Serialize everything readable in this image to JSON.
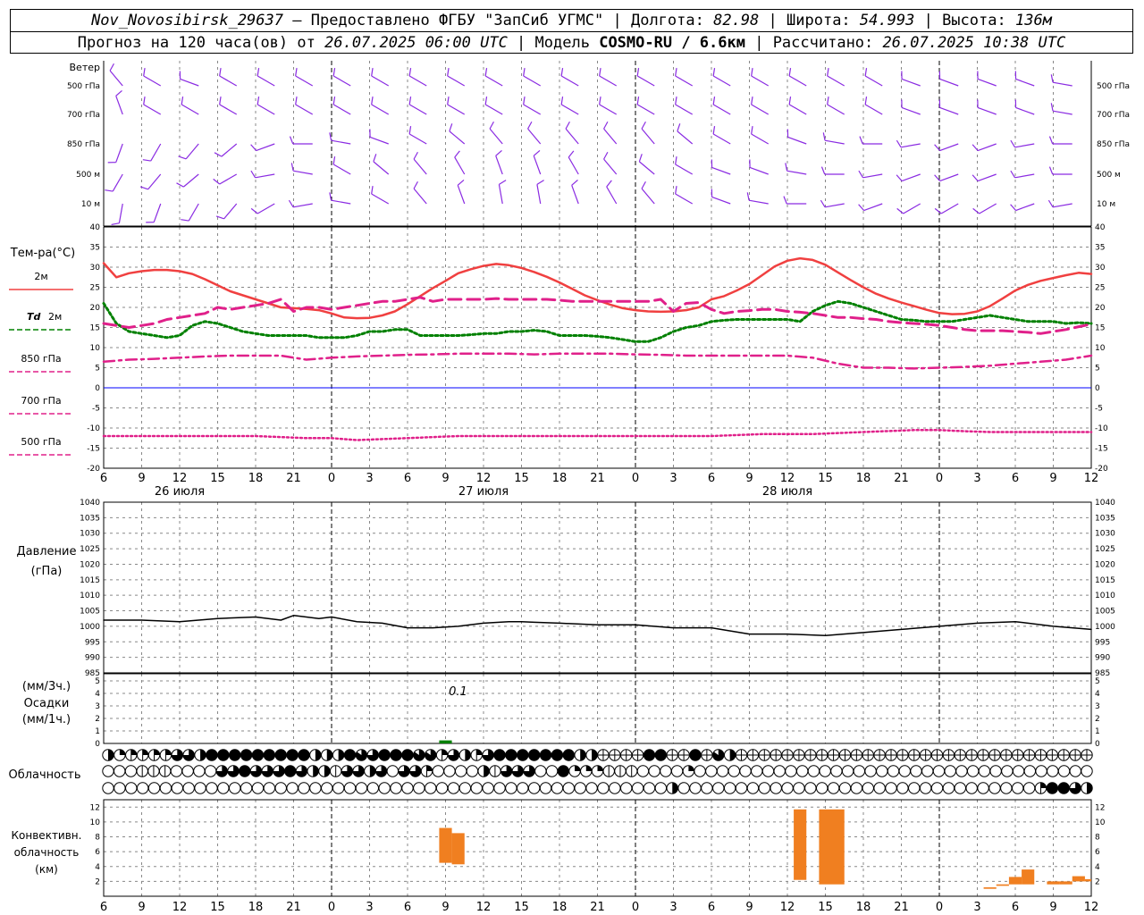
{
  "header": {
    "station": "Nov_Novosibirsk_29637",
    "provider": "– Предоставлено ФГБУ \"ЗапСиб УГМС\"",
    "lon_label": "Долгота:",
    "lon": "82.98",
    "lat_label": "Широта:",
    "lat": "54.993",
    "alt_label": "Высота:",
    "alt": "136м",
    "fc_label": "Прогноз на 120 часа(ов) от",
    "fc_time": "26.07.2025 06:00 UTC",
    "model_label": "Модель",
    "model": "COSMO-RU / 6.6км",
    "calc_label": "Рассчитано:",
    "calc_time": "26.07.2025 10:38 UTC"
  },
  "colors": {
    "t2m": "#f04040",
    "td2m": "#008000",
    "t850": "#e0208a",
    "t700": "#e0208a",
    "t500": "#e0208a",
    "wind": "#8a2be2",
    "pressure": "#000000",
    "precip": "#008000",
    "conv": "#f07f20",
    "zero_line": "#0000ff"
  },
  "time_axis": {
    "start_hour": 6,
    "hours": 78,
    "step_h": 3,
    "tick_labels": [
      "6",
      "9",
      "12",
      "15",
      "18",
      "21",
      "0",
      "3",
      "6",
      "9",
      "12",
      "15",
      "18",
      "21",
      "0",
      "3",
      "6",
      "9",
      "12",
      "15",
      "18",
      "21",
      "0",
      "3",
      "6",
      "9",
      "12"
    ],
    "dates": [
      {
        "label": "26 июля",
        "at_hour": 6
      },
      {
        "label": "27 июля",
        "at_hour": 30
      },
      {
        "label": "28 июля",
        "at_hour": 54
      }
    ],
    "midnights_h": [
      18,
      42,
      66
    ]
  },
  "wind_panel": {
    "title": "Ветер",
    "levels": [
      "500 гПа",
      "700 гПа",
      "850 гПа",
      "500 м",
      "10  м"
    ],
    "directions_deg": [
      [
        320,
        300,
        290,
        300,
        300,
        300,
        300,
        300,
        300,
        300,
        300,
        300,
        300,
        300,
        300,
        300,
        300,
        300,
        300,
        300,
        300,
        290,
        290,
        290,
        290,
        280
      ],
      [
        340,
        300,
        300,
        300,
        300,
        300,
        300,
        300,
        300,
        300,
        300,
        300,
        300,
        300,
        300,
        300,
        300,
        300,
        300,
        300,
        300,
        290,
        290,
        290,
        290,
        280
      ],
      [
        200,
        210,
        220,
        230,
        250,
        270,
        280,
        290,
        300,
        310,
        320,
        320,
        320,
        320,
        320,
        310,
        300,
        300,
        290,
        280,
        270,
        260,
        250,
        250,
        260,
        270
      ],
      [
        210,
        220,
        230,
        240,
        260,
        280,
        300,
        310,
        320,
        330,
        340,
        340,
        330,
        320,
        310,
        300,
        290,
        290,
        280,
        270,
        260,
        250,
        250,
        250,
        260,
        270
      ],
      [
        190,
        200,
        210,
        220,
        240,
        260,
        280,
        300,
        320,
        340,
        350,
        350,
        340,
        330,
        320,
        300,
        290,
        280,
        270,
        260,
        250,
        240,
        240,
        240,
        250,
        260
      ]
    ]
  },
  "temp_panel": {
    "title": "Тем-ра(°C)",
    "legend": [
      {
        "key": "t2m",
        "label": "2м"
      },
      {
        "key": "td2m",
        "label": "2м",
        "prefix": "Td"
      },
      {
        "key": "t850",
        "label": "850 гПа"
      },
      {
        "key": "t700",
        "label": "700 гПа"
      },
      {
        "key": "t500",
        "label": "500 гПа"
      }
    ],
    "y_ticks": [
      "40",
      "35",
      "30",
      "25",
      "20",
      "15",
      "10",
      "5",
      "0",
      "-5",
      "-10",
      "-15",
      "-20"
    ]
  },
  "pressure_panel": {
    "title_1": "Давление",
    "title_2": "(гПа)",
    "y_ticks": [
      "1040",
      "1035",
      "1030",
      "1025",
      "1020",
      "1015",
      "1010",
      "1005",
      "1000",
      "995",
      "990",
      "985"
    ]
  },
  "precip_panel": {
    "title_1": "(мм/3ч.)",
    "title_2": "Осадки",
    "title_3": "(мм/1ч.)",
    "y_ticks": [
      "5",
      "4",
      "3",
      "2",
      "1",
      "0"
    ],
    "annotation": "0.1",
    "annotation_hour": 27,
    "annotation_value": 0.1
  },
  "cloud_panel": {
    "title": "Облачность",
    "rows": [
      "abccccddaeeeeeeeeeaaaefgeeeffcdacdeeeeeeeaa0000ee00e0fa0000000000000000000000000000000",
      "ooohhhooooddedddedaahddadoddcooooahdddooebbbhhhoooobooooooooooooooooooooooooooooooooooo",
      "oooooooooooooooooooooooooooooooooooooooooooooooooaoooooooooooooooooooooooooooooooceeda"
    ]
  },
  "conv_panel": {
    "title_1": "Конвективн.",
    "title_2": "облачность",
    "title_3": "(км)",
    "y_ticks": [
      "12",
      "10",
      "8",
      "6",
      "4",
      "2"
    ]
  },
  "chart_data": [
    {
      "type": "line",
      "title": "Тем-ра(°C)",
      "x_unit": "hours from 26.07.2025 06 UTC",
      "ylim": [
        -20,
        40
      ],
      "series": [
        {
          "name": "2м",
          "key": "t2m",
          "style": "solid",
          "x": [
            0,
            1,
            2,
            3,
            4,
            5,
            6,
            7,
            8,
            9,
            10,
            11,
            12,
            13,
            14,
            15,
            16,
            17,
            18,
            19,
            20,
            21,
            22,
            23,
            24,
            25,
            26,
            27,
            28,
            29,
            30,
            31,
            32,
            33,
            34,
            35,
            36,
            37,
            38,
            39,
            40,
            41,
            42,
            43,
            44,
            45,
            46,
            47,
            48,
            49,
            50,
            51,
            52,
            53,
            54,
            55,
            56,
            57,
            58,
            59,
            60,
            61,
            62,
            63,
            64,
            65,
            66,
            67,
            68,
            69,
            70,
            71,
            72,
            73,
            74,
            75,
            76,
            77,
            78
          ],
          "y": [
            31,
            27.5,
            28.5,
            29,
            29.3,
            29.3,
            29,
            28.3,
            27,
            25.5,
            24,
            23,
            22,
            21,
            20,
            19.8,
            19.6,
            19.3,
            18.5,
            17.5,
            17.3,
            17.4,
            18,
            19,
            20.8,
            22.8,
            24.8,
            26.6,
            28.5,
            29.5,
            30.3,
            30.8,
            30.5,
            29.8,
            28.8,
            27.6,
            26.2,
            24.6,
            23,
            21.8,
            20.7,
            19.8,
            19.3,
            19,
            18.9,
            19,
            19.3,
            20,
            22,
            22.8,
            24.2,
            25.8,
            28,
            30.2,
            31.6,
            32.2,
            31.8,
            30.6,
            28.7,
            26.8,
            25,
            23.4,
            22.2,
            21.2,
            20.3,
            19.4,
            18.6,
            18.3,
            18.4,
            19,
            20.3,
            22.2,
            24.2,
            25.6,
            26.6,
            27.3,
            28,
            28.6,
            28.3
          ]
        },
        {
          "name": "2м",
          "key": "td2m",
          "style": "dotted",
          "x": [
            0,
            1,
            2,
            3,
            4,
            5,
            6,
            7,
            8,
            9,
            10,
            11,
            12,
            13,
            14,
            15,
            16,
            17,
            18,
            19,
            20,
            21,
            22,
            23,
            24,
            25,
            26,
            27,
            28,
            29,
            30,
            31,
            32,
            33,
            34,
            35,
            36,
            37,
            38,
            39,
            40,
            41,
            42,
            43,
            44,
            45,
            46,
            47,
            48,
            49,
            50,
            51,
            52,
            53,
            54,
            55,
            56,
            57,
            58,
            59,
            60,
            61,
            62,
            63,
            64,
            65,
            66,
            67,
            68,
            69,
            70,
            71,
            72,
            73,
            74,
            75,
            76,
            77,
            78
          ],
          "y": [
            21,
            16,
            14,
            13.5,
            13,
            12.5,
            13,
            15.5,
            16.5,
            16,
            15,
            14,
            13.5,
            13,
            13,
            13,
            13,
            12.5,
            12.5,
            12.5,
            13,
            14,
            14,
            14.5,
            14.5,
            13,
            13,
            13,
            13,
            13.2,
            13.5,
            13.5,
            14,
            14,
            14.3,
            14,
            13,
            13,
            13,
            12.8,
            12.5,
            12,
            11.5,
            11.5,
            12.5,
            14,
            15,
            15.5,
            16.5,
            16.8,
            17,
            17,
            17,
            17,
            17,
            16.5,
            19,
            20.5,
            21.5,
            21,
            20,
            19,
            18,
            17,
            16.8,
            16.5,
            16.5,
            16.5,
            17,
            17.5,
            18,
            17.5,
            17,
            16.5,
            16.5,
            16.5,
            16,
            16.2,
            16
          ]
        },
        {
          "name": "850 гПа",
          "key": "t850",
          "style": "dashed",
          "x": [
            0,
            1,
            2,
            3,
            4,
            5,
            6,
            7,
            8,
            9,
            10,
            11,
            12,
            13,
            14,
            15,
            16,
            17,
            18,
            19,
            20,
            21,
            22,
            23,
            24,
            25,
            26,
            27,
            28,
            29,
            30,
            31,
            32,
            33,
            34,
            35,
            36,
            37,
            38,
            39,
            40,
            41,
            42,
            43,
            44,
            45,
            46,
            47,
            48,
            49,
            50,
            51,
            52,
            53,
            54,
            55,
            56,
            57,
            58,
            59,
            60,
            61,
            62,
            63,
            64,
            65,
            66,
            67,
            68,
            69,
            70,
            71,
            72,
            73,
            74,
            75,
            76,
            77,
            78
          ],
          "y": [
            16,
            15.5,
            15,
            15.5,
            16,
            17,
            17.5,
            18,
            18.5,
            20,
            19.5,
            20,
            20.5,
            21,
            22,
            19,
            20,
            20,
            19.5,
            20,
            20.5,
            21,
            21.5,
            21.5,
            22,
            22.5,
            21.5,
            22,
            22,
            22,
            22,
            22.2,
            22,
            22,
            22,
            22,
            21.8,
            21.5,
            21.5,
            21.5,
            21.5,
            21.5,
            21.5,
            21.5,
            22,
            19,
            21,
            21.2,
            19.5,
            18.5,
            19,
            19.2,
            19.5,
            19.5,
            19,
            18.8,
            18.5,
            18,
            17.5,
            17.5,
            17.2,
            17,
            16.5,
            16.2,
            16,
            15.8,
            15.5,
            15,
            14.5,
            14.2,
            14.2,
            14.2,
            14,
            13.8,
            13.5,
            14,
            14.5,
            15.2,
            15.8
          ]
        },
        {
          "name": "700 гПа",
          "key": "t700",
          "style": "dashdot",
          "x": [
            0,
            2,
            4,
            6,
            8,
            10,
            12,
            14,
            16,
            18,
            20,
            22,
            24,
            26,
            28,
            30,
            32,
            34,
            36,
            38,
            40,
            42,
            44,
            46,
            48,
            50,
            52,
            54,
            56,
            58,
            60,
            62,
            64,
            66,
            68,
            70,
            72,
            74,
            76,
            78
          ],
          "y": [
            6.5,
            7,
            7.2,
            7.5,
            7.8,
            8,
            8,
            8,
            7,
            7.5,
            7.8,
            8,
            8.2,
            8.3,
            8.5,
            8.5,
            8.5,
            8.3,
            8.5,
            8.5,
            8.5,
            8.3,
            8.2,
            8,
            8,
            8,
            8,
            8,
            7.5,
            6,
            5,
            5,
            4.8,
            5,
            5.2,
            5.5,
            6,
            6.5,
            7,
            8
          ]
        },
        {
          "name": "500 гПа",
          "key": "t500",
          "style": "fine_dotted",
          "x": [
            0,
            4,
            8,
            12,
            16,
            18,
            20,
            24,
            28,
            32,
            36,
            40,
            44,
            48,
            52,
            56,
            60,
            64,
            66,
            68,
            70,
            74,
            78
          ],
          "y": [
            -12,
            -12,
            -12,
            -12,
            -12.5,
            -12.5,
            -13,
            -12.5,
            -12,
            -12,
            -12,
            -12,
            -12,
            -12,
            -11.5,
            -11.5,
            -11,
            -10.5,
            -10.5,
            -10.8,
            -11,
            -11,
            -11
          ]
        }
      ]
    },
    {
      "type": "line",
      "title": "Давление",
      "ylim": [
        985,
        1040
      ],
      "series": [
        {
          "name": "",
          "key": "pressure",
          "style": "solid",
          "x": [
            0,
            3,
            6,
            9,
            12,
            14,
            15,
            16,
            17,
            18,
            20,
            22,
            24,
            26,
            28,
            30,
            32,
            33,
            34,
            36,
            39,
            42,
            45,
            48,
            51,
            54,
            57,
            60,
            63,
            66,
            69,
            72,
            75,
            78
          ],
          "y": [
            1002,
            1002,
            1001.5,
            1002.5,
            1003,
            1002,
            1003.5,
            1003,
            1002.5,
            1003,
            1001.5,
            1001,
            999.5,
            999.5,
            1000,
            1001,
            1001.5,
            1001.5,
            1001.3,
            1001,
            1000.5,
            1000.5,
            999.5,
            999.5,
            997.5,
            997.5,
            997,
            998,
            999,
            1000,
            1001,
            1001.5,
            1000,
            999
          ]
        }
      ]
    },
    {
      "type": "bar",
      "title": "Осадки",
      "ylim": [
        0,
        5
      ],
      "series": [
        {
          "name": "",
          "key": "precip",
          "x": [
            27
          ],
          "values": [
            0.1
          ]
        }
      ]
    },
    {
      "type": "bar",
      "title": "Конвективн. облачность",
      "ylim": [
        0,
        13
      ],
      "series": [
        {
          "name": "",
          "key": "conv",
          "bars": [
            {
              "x_from": 26.5,
              "x_to": 27.5,
              "base": 4.5,
              "top": 9.2
            },
            {
              "x_from": 27.5,
              "x_to": 28.5,
              "base": 4.3,
              "top": 8.5
            },
            {
              "x_from": 54.5,
              "x_to": 55.5,
              "base": 2.2,
              "top": 11.7
            },
            {
              "x_from": 56.5,
              "x_to": 58.5,
              "base": 1.6,
              "top": 11.7
            },
            {
              "x_from": 69.5,
              "x_to": 70.5,
              "base": 1.0,
              "top": 1.2
            },
            {
              "x_from": 70.5,
              "x_to": 71.5,
              "base": 1.4,
              "top": 1.6
            },
            {
              "x_from": 71.5,
              "x_to": 72.5,
              "base": 1.6,
              "top": 2.6
            },
            {
              "x_from": 72.5,
              "x_to": 73.5,
              "base": 1.6,
              "top": 3.6
            },
            {
              "x_from": 74.5,
              "x_to": 75.5,
              "base": 1.6,
              "top": 2.0
            },
            {
              "x_from": 75.5,
              "x_to": 76.5,
              "base": 1.6,
              "top": 2.0
            },
            {
              "x_from": 76.5,
              "x_to": 77.5,
              "base": 2.0,
              "top": 2.7
            },
            {
              "x_from": 77.5,
              "x_to": 78.0,
              "base": 2.0,
              "top": 2.3
            }
          ]
        }
      ]
    }
  ]
}
